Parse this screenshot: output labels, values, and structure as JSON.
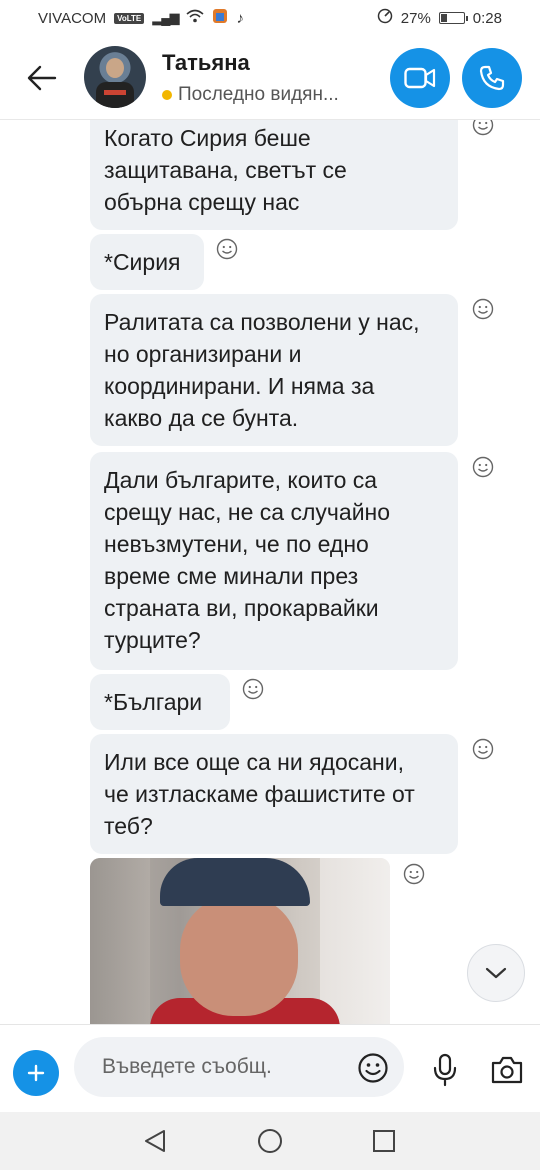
{
  "status_bar": {
    "carrier": "VIVACOM",
    "volte": "VoLTE",
    "battery": "27%",
    "battery_level": 0.27,
    "time": "0:28"
  },
  "header": {
    "contact_name": "Татьяна",
    "contact_status": "Последно видян...",
    "status_color": "#f2b600",
    "accent": "#1592e6"
  },
  "messages": [
    {
      "text": "Когато Сирия беше\nзащитавана, светът се\nобърна срещу нас"
    },
    {
      "text": "*Сирия"
    },
    {
      "text": "Ралитата са позволени у нас,\nно организирани и\nкоординирани. И няма за\nкакво да се бунта."
    },
    {
      "text": "Дали българите, които са\nсрещу нас, не са случайно\nневъзмутени, че по едно\nвреме сме минали през\nстраната ви, прокарвайки\nтурците?"
    },
    {
      "text": "*Българи"
    },
    {
      "text": "Или все още са ни ядосани,\nче изтласкаме фашистите от\nтеб?"
    }
  ],
  "composer": {
    "placeholder": "Въведете съобщ."
  },
  "icons": {
    "back": "arrow-left-icon",
    "video": "video-camera-icon",
    "call": "phone-icon",
    "react": "smiley-icon",
    "scroll": "chevron-down-icon",
    "add": "plus-icon",
    "emoji": "emoji-icon",
    "mic": "microphone-icon",
    "camera": "camera-icon"
  }
}
